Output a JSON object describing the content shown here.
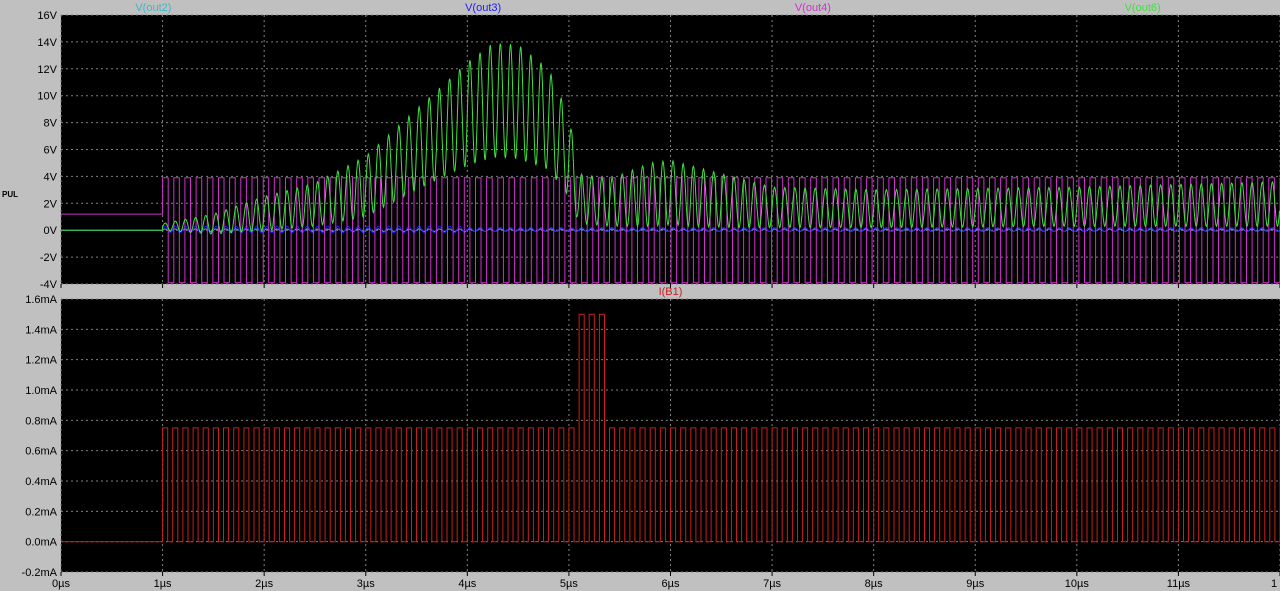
{
  "side_label": "PUL",
  "chart_data": [
    {
      "type": "line",
      "pane": "top",
      "series": [
        {
          "name": "V(out2)",
          "color": "#3cb8c8",
          "kind": "flat_then_small_wiggle",
          "values_summary": {
            "pre_1us": 0.0
          }
        },
        {
          "name": "V(out3)",
          "color": "#1a1aff",
          "kind": "ripple_near_zero",
          "values_summary": {
            "min": -0.5,
            "max": 0.6
          }
        },
        {
          "name": "V(out4)",
          "color": "#d030d0",
          "kind": "square_wave",
          "values_summary": {
            "pre_1us": 1.2,
            "high": 3.9,
            "low": -3.9,
            "period_us": 0.11
          }
        },
        {
          "name": "V(out6)",
          "color": "#40e040",
          "kind": "modulated_oscillation",
          "envelope_x": [
            0,
            1.0,
            1.5,
            2.0,
            2.5,
            3.0,
            3.5,
            4.0,
            4.25,
            4.5,
            4.8,
            5.0,
            5.1,
            5.4,
            5.8,
            6.0,
            6.2,
            6.6,
            7.0,
            8.0,
            10.0,
            12.0
          ],
          "envelope_max": [
            0,
            0.5,
            1.2,
            2.5,
            3.5,
            5.5,
            9.0,
            12.5,
            13.9,
            13.8,
            12.0,
            8.5,
            4.2,
            3.8,
            5.0,
            5.2,
            4.8,
            4.0,
            3.2,
            3.0,
            3.2,
            3.6
          ],
          "envelope_min": [
            0,
            0.0,
            -0.3,
            0.0,
            0.3,
            1.0,
            3.0,
            4.8,
            5.4,
            5.3,
            4.5,
            2.5,
            0.5,
            0.3,
            0.3,
            0.4,
            0.3,
            0.2,
            0.2,
            0.2,
            0.3,
            0.3
          ]
        }
      ],
      "ylim": [
        -4,
        16
      ],
      "yticks": [
        "-4V",
        "-2V",
        "0V",
        "2V",
        "4V",
        "6V",
        "8V",
        "10V",
        "12V",
        "14V",
        "16V"
      ],
      "xlim": [
        0,
        12
      ],
      "grid": true
    },
    {
      "type": "line",
      "pane": "bottom",
      "series": [
        {
          "name": "I(B1)",
          "color": "#c82020",
          "kind": "pulse_train",
          "values_summary": {
            "pre_1us": 0.0,
            "normal_amplitude_mA": 0.75,
            "burst_amplitude_mA": 1.5,
            "burst_start_us": 5.0,
            "burst_end_us": 5.3,
            "period_us": 0.1
          }
        }
      ],
      "ylim": [
        -0.2,
        1.6
      ],
      "yticks": [
        "-0.2mA",
        "0.0mA",
        "0.2mA",
        "0.4mA",
        "0.6mA",
        "0.8mA",
        "1.0mA",
        "1.2mA",
        "1.4mA",
        "1.6mA"
      ],
      "xlim": [
        0,
        12
      ],
      "xticks": [
        "0µs",
        "1µs",
        "2µs",
        "3µs",
        "4µs",
        "5µs",
        "6µs",
        "7µs",
        "8µs",
        "9µs",
        "10µs",
        "11µs",
        "1"
      ],
      "grid": true
    }
  ]
}
